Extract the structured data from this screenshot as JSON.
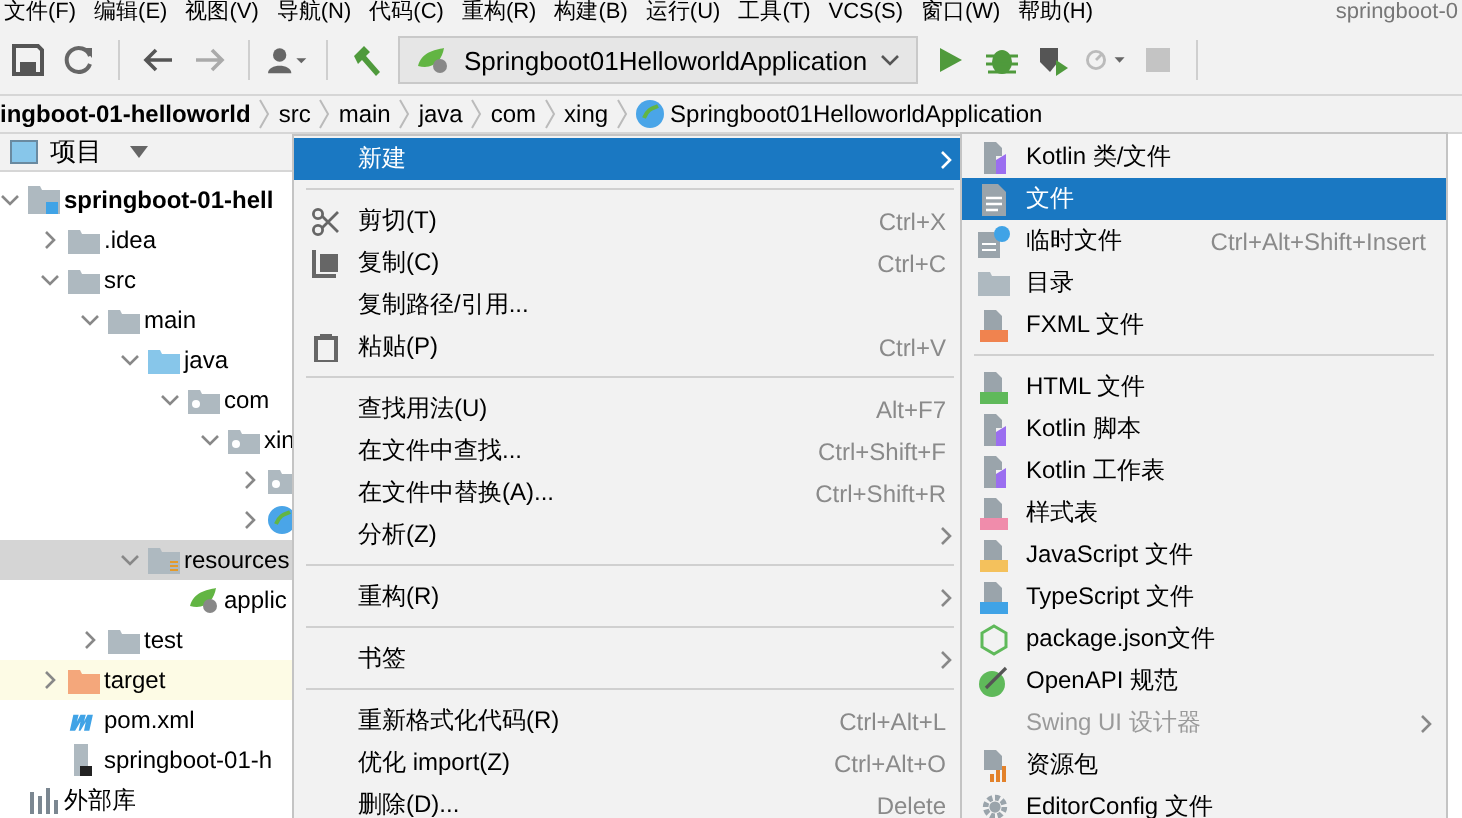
{
  "menu_bar": {
    "items": [
      "文件(F)",
      "编辑(E)",
      "视图(V)",
      "导航(N)",
      "代码(C)",
      "重构(R)",
      "构建(B)",
      "运行(U)",
      "工具(T)",
      "VCS(S)",
      "窗口(W)",
      "帮助(H)"
    ],
    "title": "springboot-0"
  },
  "run_config": {
    "label": "Springboot01HelloworldApplication"
  },
  "breadcrumb": [
    "ingboot-01-helloworld",
    "src",
    "main",
    "java",
    "com",
    "xing",
    "Springboot01HelloworldApplication"
  ],
  "project_panel": {
    "title": "项目"
  },
  "tree": [
    {
      "kind": "module",
      "label": "springboot-01-hell",
      "expanded": true,
      "selected": false,
      "excluded": false,
      "children": [
        {
          "kind": "folder",
          "label": ".idea",
          "expanded": false,
          "selected": false,
          "excluded": false
        },
        {
          "kind": "folder",
          "label": "src",
          "expanded": true,
          "selected": false,
          "excluded": false,
          "children": [
            {
              "kind": "folder",
              "label": "main",
              "expanded": true,
              "selected": false,
              "excluded": false,
              "children": [
                {
                  "kind": "source",
                  "label": "java",
                  "expanded": true,
                  "selected": false,
                  "excluded": false,
                  "children": [
                    {
                      "kind": "package",
                      "label": "com",
                      "expanded": true,
                      "selected": false,
                      "excluded": false,
                      "children": [
                        {
                          "kind": "package",
                          "label": "xin",
                          "expanded": true,
                          "selected": false,
                          "excluded": false,
                          "children": [
                            {
                              "kind": "package",
                              "expanded": false,
                              "selected": false,
                              "excluded": false
                            },
                            {
                              "kind": "spring",
                              "expanded": false,
                              "selected": false,
                              "excluded": false
                            }
                          ]
                        }
                      ]
                    }
                  ]
                },
                {
                  "kind": "resources",
                  "label": "resources",
                  "expanded": true,
                  "selected": true,
                  "excluded": false,
                  "children": [
                    {
                      "kind": "config",
                      "label": "applic",
                      "selected": false,
                      "excluded": false
                    }
                  ]
                }
              ]
            },
            {
              "kind": "folder",
              "label": "test",
              "expanded": false,
              "selected": false,
              "excluded": false
            }
          ]
        },
        {
          "kind": "excluded",
          "label": "target",
          "expanded": false,
          "selected": false,
          "excluded": true
        },
        {
          "kind": "maven",
          "label": "pom.xml",
          "selected": false,
          "excluded": false
        },
        {
          "kind": "file",
          "label": "springboot-01-h",
          "selected": false,
          "excluded": false
        }
      ]
    },
    {
      "kind": "library",
      "label": "外部库",
      "selected": false,
      "excluded": false
    }
  ],
  "context_menu": [
    {
      "kind": "item",
      "label": "新建",
      "submenu": true,
      "selected": true
    },
    {
      "kind": "separator"
    },
    {
      "kind": "cut",
      "label": "剪切(T)",
      "shortcut": "Ctrl+X",
      "selected": false
    },
    {
      "kind": "copy",
      "label": "复制(C)",
      "shortcut": "Ctrl+C",
      "selected": false
    },
    {
      "kind": "item",
      "label": "复制路径/引用...",
      "selected": false
    },
    {
      "kind": "paste",
      "label": "粘贴(P)",
      "shortcut": "Ctrl+V",
      "selected": false
    },
    {
      "kind": "separator"
    },
    {
      "kind": "item",
      "label": "查找用法(U)",
      "shortcut": "Alt+F7",
      "selected": false
    },
    {
      "kind": "item",
      "label": "在文件中查找...",
      "shortcut": "Ctrl+Shift+F",
      "selected": false
    },
    {
      "kind": "item",
      "label": "在文件中替换(A)...",
      "shortcut": "Ctrl+Shift+R",
      "selected": false
    },
    {
      "kind": "item",
      "label": "分析(Z)",
      "submenu": true,
      "selected": false
    },
    {
      "kind": "separator"
    },
    {
      "kind": "item",
      "label": "重构(R)",
      "submenu": true,
      "selected": false
    },
    {
      "kind": "separator"
    },
    {
      "kind": "item",
      "label": "书签",
      "submenu": true,
      "selected": false
    },
    {
      "kind": "separator"
    },
    {
      "kind": "item",
      "label": "重新格式化代码(R)",
      "shortcut": "Ctrl+Alt+L",
      "selected": false
    },
    {
      "kind": "item",
      "label": "优化 import(Z)",
      "shortcut": "Ctrl+Alt+O",
      "selected": false
    },
    {
      "kind": "item",
      "label": "删除(D)...",
      "shortcut": "Delete",
      "selected": false
    }
  ],
  "new_submenu": [
    {
      "kind": "kotlin",
      "label": "Kotlin 类/文件",
      "selected": false,
      "disabled": false
    },
    {
      "kind": "file",
      "label": "文件",
      "selected": true,
      "disabled": false
    },
    {
      "kind": "scratch",
      "label": "临时文件",
      "shortcut": "Ctrl+Alt+Shift+Insert",
      "selected": false,
      "disabled": false
    },
    {
      "kind": "folder",
      "label": "目录",
      "selected": false,
      "disabled": false
    },
    {
      "kind": "fxml",
      "label": "FXML 文件",
      "selected": false,
      "disabled": false
    },
    {
      "kind": "separator"
    },
    {
      "kind": "html",
      "label": "HTML 文件",
      "selected": false,
      "disabled": false
    },
    {
      "kind": "kotlin",
      "label": "Kotlin 脚本",
      "selected": false,
      "disabled": false
    },
    {
      "kind": "kotlin",
      "label": "Kotlin 工作表",
      "selected": false,
      "disabled": false
    },
    {
      "kind": "css",
      "label": "样式表",
      "selected": false,
      "disabled": false
    },
    {
      "kind": "js",
      "label": "JavaScript 文件",
      "selected": false,
      "disabled": false
    },
    {
      "kind": "ts",
      "label": "TypeScript 文件",
      "selected": false,
      "disabled": false
    },
    {
      "kind": "node",
      "label": "package.json文件",
      "selected": false,
      "disabled": false
    },
    {
      "kind": "openapi",
      "label": "OpenAPI 规范",
      "selected": false,
      "disabled": false
    },
    {
      "kind": "plain",
      "label": "Swing UI 设计器",
      "submenu": true,
      "selected": false,
      "disabled": true
    },
    {
      "kind": "bundle",
      "label": "资源包",
      "selected": false,
      "disabled": false
    },
    {
      "kind": "gear",
      "label": "EditorConfig 文件",
      "selected": false,
      "disabled": false
    }
  ]
}
